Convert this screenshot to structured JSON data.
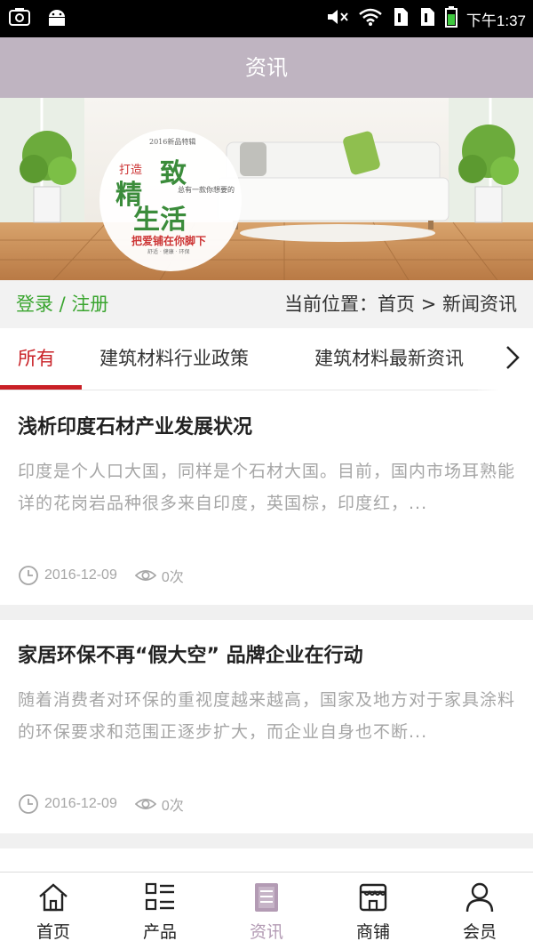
{
  "status_bar": {
    "time": "下午1:37"
  },
  "header": {
    "title": "资讯"
  },
  "banner": {
    "small_text": "2016新品特辑",
    "dazao": "打造",
    "big1": "精",
    "big2": "致",
    "big3": "生活",
    "sub": "总有一款你想要的",
    "slogan": "把爱铺在你脚下",
    "tiny": "舒适 · 健康 · 环保"
  },
  "location_bar": {
    "login": "登录 / 注册",
    "breadcrumb": "当前位置：首页 > 新闻资讯"
  },
  "tabs": [
    {
      "label": "所有"
    },
    {
      "label": "建筑材料行业政策"
    },
    {
      "label": "建筑材料最新资讯"
    }
  ],
  "news": [
    {
      "title": "浅析印度石材产业发展状况",
      "summary": "印度是个人口大国，同样是个石材大国。目前，国内市场耳熟能详的花岗岩品种很多来自印度，英国棕，印度红，...",
      "date": "2016-12-09",
      "views": "0次"
    },
    {
      "title": "家居环保不再“假大空” 品牌企业在行动",
      "summary": "随着消费者对环保的重视度越来越高，国家及地方对于家具涂料的环保要求和范围正逐步扩大，而企业自身也不断...",
      "date": "2016-12-09",
      "views": "0次"
    }
  ],
  "bottom_nav": [
    {
      "label": "首页",
      "icon": "home-icon"
    },
    {
      "label": "产品",
      "icon": "grid-list-icon"
    },
    {
      "label": "资讯",
      "icon": "document-icon"
    },
    {
      "label": "商铺",
      "icon": "shop-icon"
    },
    {
      "label": "会员",
      "icon": "user-icon"
    }
  ],
  "colors": {
    "title_bar": "#bfb4c1",
    "active_tab": "#c92026",
    "login_link": "#3aa52f",
    "nav_active": "#b39bb4"
  }
}
